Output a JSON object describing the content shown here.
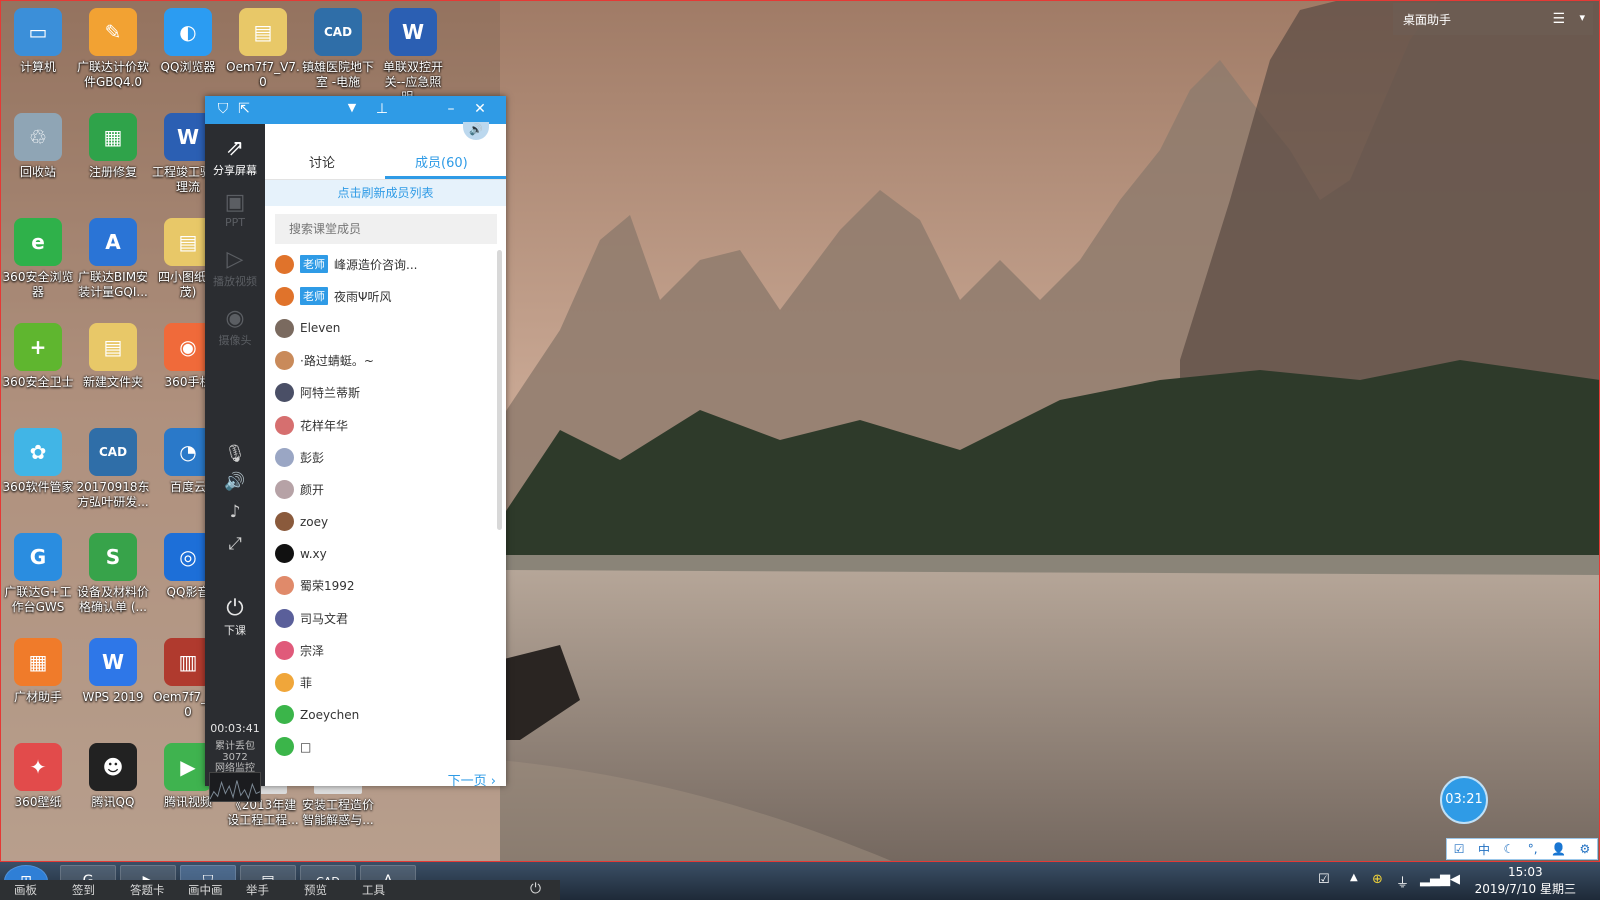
{
  "desktop": {
    "icons": [
      {
        "label": "计算机",
        "glyph": "▭",
        "color": "#3b8fd9"
      },
      {
        "label": "广联达计价软件GBQ4.0",
        "glyph": "✎",
        "color": "#f2a233"
      },
      {
        "label": "QQ浏览器",
        "glyph": "◐",
        "color": "#2b9cf2"
      },
      {
        "label": "Oem7f7_V7.0",
        "glyph": "▤",
        "color": "#e8c868"
      },
      {
        "label": "镇雄医院地下室 -电施",
        "glyph": "CAD",
        "color": "#2f6ea8"
      },
      {
        "label": "单联双控开关--应急照明...",
        "glyph": "W",
        "color": "#2b5fb3"
      },
      {
        "label": "回收站",
        "glyph": "♲",
        "color": "#8fa5b5"
      },
      {
        "label": "注册修复",
        "glyph": "▦",
        "color": "#2fa34a"
      },
      {
        "label": "工程竣工验管理流",
        "glyph": "W",
        "color": "#2b5fb3"
      },
      {
        "label": "360安全浏览器",
        "glyph": "e",
        "color": "#2fb14a"
      },
      {
        "label": "广联达BIM安装计量GQI...",
        "glyph": "A",
        "color": "#2a74d6"
      },
      {
        "label": "四小图纸欣茂)",
        "glyph": "▤",
        "color": "#e8c868"
      },
      {
        "label": "360安全卫士",
        "glyph": "+",
        "color": "#5fb62f"
      },
      {
        "label": "新建文件夹",
        "glyph": "▤",
        "color": "#e8c868"
      },
      {
        "label": "360手机",
        "glyph": "◉",
        "color": "#f06a3a"
      },
      {
        "label": "360软件管家",
        "glyph": "✿",
        "color": "#41b5e6"
      },
      {
        "label": "20170918东方弘叶研发...",
        "glyph": "CAD",
        "color": "#2f6ea8"
      },
      {
        "label": "百度云",
        "glyph": "◔",
        "color": "#2a79c9"
      },
      {
        "label": "广联达G+工作台GWS",
        "glyph": "G",
        "color": "#2a8de0"
      },
      {
        "label": "设备及材料价格确认单 (...",
        "glyph": "S",
        "color": "#37a34a"
      },
      {
        "label": "QQ影音",
        "glyph": "◎",
        "color": "#1d6fd8"
      },
      {
        "label": "广材助手",
        "glyph": "▦",
        "color": "#f07b2a"
      },
      {
        "label": "WPS 2019",
        "glyph": "W",
        "color": "#2e77e8"
      },
      {
        "label": "Oem7f7_V70",
        "glyph": "▥",
        "color": "#b03a2e"
      },
      {
        "label": "360壁纸",
        "glyph": "✦",
        "color": "#e24b4b"
      },
      {
        "label": "腾讯QQ",
        "glyph": "☻",
        "color": "#222222"
      },
      {
        "label": "腾讯视频",
        "glyph": "▶",
        "color": "#3fb34f"
      },
      {
        "label": "《2013年建设工程工程...",
        "glyph": "",
        "color": "#dcdcdc"
      },
      {
        "label": "安装工程造价智能解惑与...",
        "glyph": "",
        "color": "#dcdcdc"
      }
    ],
    "helper_title": "桌面助手"
  },
  "panel": {
    "side_tools": [
      {
        "label": "分享屏幕",
        "glyph": "⇗",
        "active": true
      },
      {
        "label": "PPT",
        "glyph": "▣",
        "active": false
      },
      {
        "label": "播放视频",
        "glyph": "▷",
        "active": false
      },
      {
        "label": "摄像头",
        "glyph": "◉",
        "active": false
      }
    ],
    "end_class_label": "下课",
    "timer": "00:03:41",
    "net_lines": [
      "累计丢包",
      "3072",
      "网络监控"
    ],
    "tabs": {
      "discussion": "讨论",
      "members": "成员(60)"
    },
    "refresh_label": "点击刷新成员列表",
    "search_placeholder": "搜索课堂成员",
    "members": [
      {
        "name": "峰源造价咨询...",
        "role": "老师",
        "avatar_color": "#e0732b"
      },
      {
        "name": "夜雨Ψ听风",
        "role": "老师",
        "avatar_color": "#e0732b"
      },
      {
        "name": "Eleven",
        "role": "",
        "avatar_color": "#7a6a5f"
      },
      {
        "name": "·路过蜻蜓。~",
        "role": "",
        "avatar_color": "#c98a5a"
      },
      {
        "name": "阿特兰蒂斯",
        "role": "",
        "avatar_color": "#4a4f66"
      },
      {
        "name": "花样年华",
        "role": "",
        "avatar_color": "#d66f6f"
      },
      {
        "name": "彭彭",
        "role": "",
        "avatar_color": "#9aa6c4"
      },
      {
        "name": "颜开",
        "role": "",
        "avatar_color": "#b6a2a6"
      },
      {
        "name": "zoey",
        "role": "",
        "avatar_color": "#8a5a3c"
      },
      {
        "name": "w.xy",
        "role": "",
        "avatar_color": "#111111"
      },
      {
        "name": "蜀荣1992",
        "role": "",
        "avatar_color": "#e08a6a"
      },
      {
        "name": "司马文君",
        "role": "",
        "avatar_color": "#5a5f9a"
      },
      {
        "name": "宗泽",
        "role": "",
        "avatar_color": "#e05a7a"
      },
      {
        "name": "菲",
        "role": "",
        "avatar_color": "#f0a63a"
      },
      {
        "name": "Zoeychen",
        "role": "",
        "avatar_color": "#3bb54a"
      },
      {
        "name": "□",
        "role": "",
        "avatar_color": "#3bb54a"
      }
    ],
    "next_page": "下一页 ›",
    "speaker_icon": "🔊"
  },
  "bubble_timer": "03:21",
  "ime": [
    "中",
    "☾",
    "°,",
    "👤",
    "⚙"
  ],
  "taskbar": {
    "strip_items": [
      "画板",
      "签到",
      "答题卡",
      "画中画",
      "举手",
      "预览",
      "工具"
    ],
    "clock_time": "15:03",
    "clock_date": "2019/7/10 星期三"
  },
  "colors": {
    "accent": "#2f9be6",
    "side_bg": "#2b2d31"
  }
}
